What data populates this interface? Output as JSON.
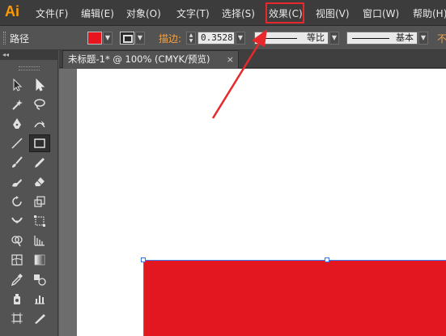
{
  "app": {
    "logo": "Ai"
  },
  "menu": [
    {
      "label": "文件(F)"
    },
    {
      "label": "编辑(E)"
    },
    {
      "label": "对象(O)"
    },
    {
      "label": "文字(T)"
    },
    {
      "label": "选择(S)"
    },
    {
      "label": "效果(C)",
      "highlighted": true
    },
    {
      "label": "视图(V)"
    },
    {
      "label": "窗口(W)"
    },
    {
      "label": "帮助(H)"
    }
  ],
  "control_bar": {
    "selection_label": "路径",
    "fill_color": "#e8141e",
    "stroke_label": "描边:",
    "stroke_weight": "0.3528",
    "variable_width_profile": "等比",
    "brush_definition": "基本",
    "opacity_label_partial": "不"
  },
  "tools_panel": {
    "collapse_glyph": "◂◂",
    "tools": [
      "selection-tool",
      "direct-selection-tool",
      "magic-wand-tool",
      "lasso-tool",
      "pen-tool",
      "curvature-tool",
      "line-segment-tool",
      "rectangle-tool",
      "paintbrush-tool",
      "pencil-tool",
      "blob-brush-tool",
      "eraser-tool",
      "rotate-tool",
      "scale-tool",
      "width-tool",
      "free-transform-tool",
      "shape-builder-tool",
      "perspective-grid-tool",
      "mesh-tool",
      "gradient-tool",
      "eyedropper-tool",
      "blend-tool",
      "symbol-sprayer-tool",
      "column-graph-tool",
      "artboard-tool",
      "slice-tool"
    ],
    "active_tool": "rectangle-tool"
  },
  "document": {
    "tab_title": "未标题-1* @ 100% (CMYK/预览)",
    "close_glyph": "×"
  },
  "canvas": {
    "shape_fill": "#e31720",
    "selection_color": "#2f6fe8"
  },
  "annotation": {
    "color": "#e8282a",
    "target": "效果(C)"
  }
}
